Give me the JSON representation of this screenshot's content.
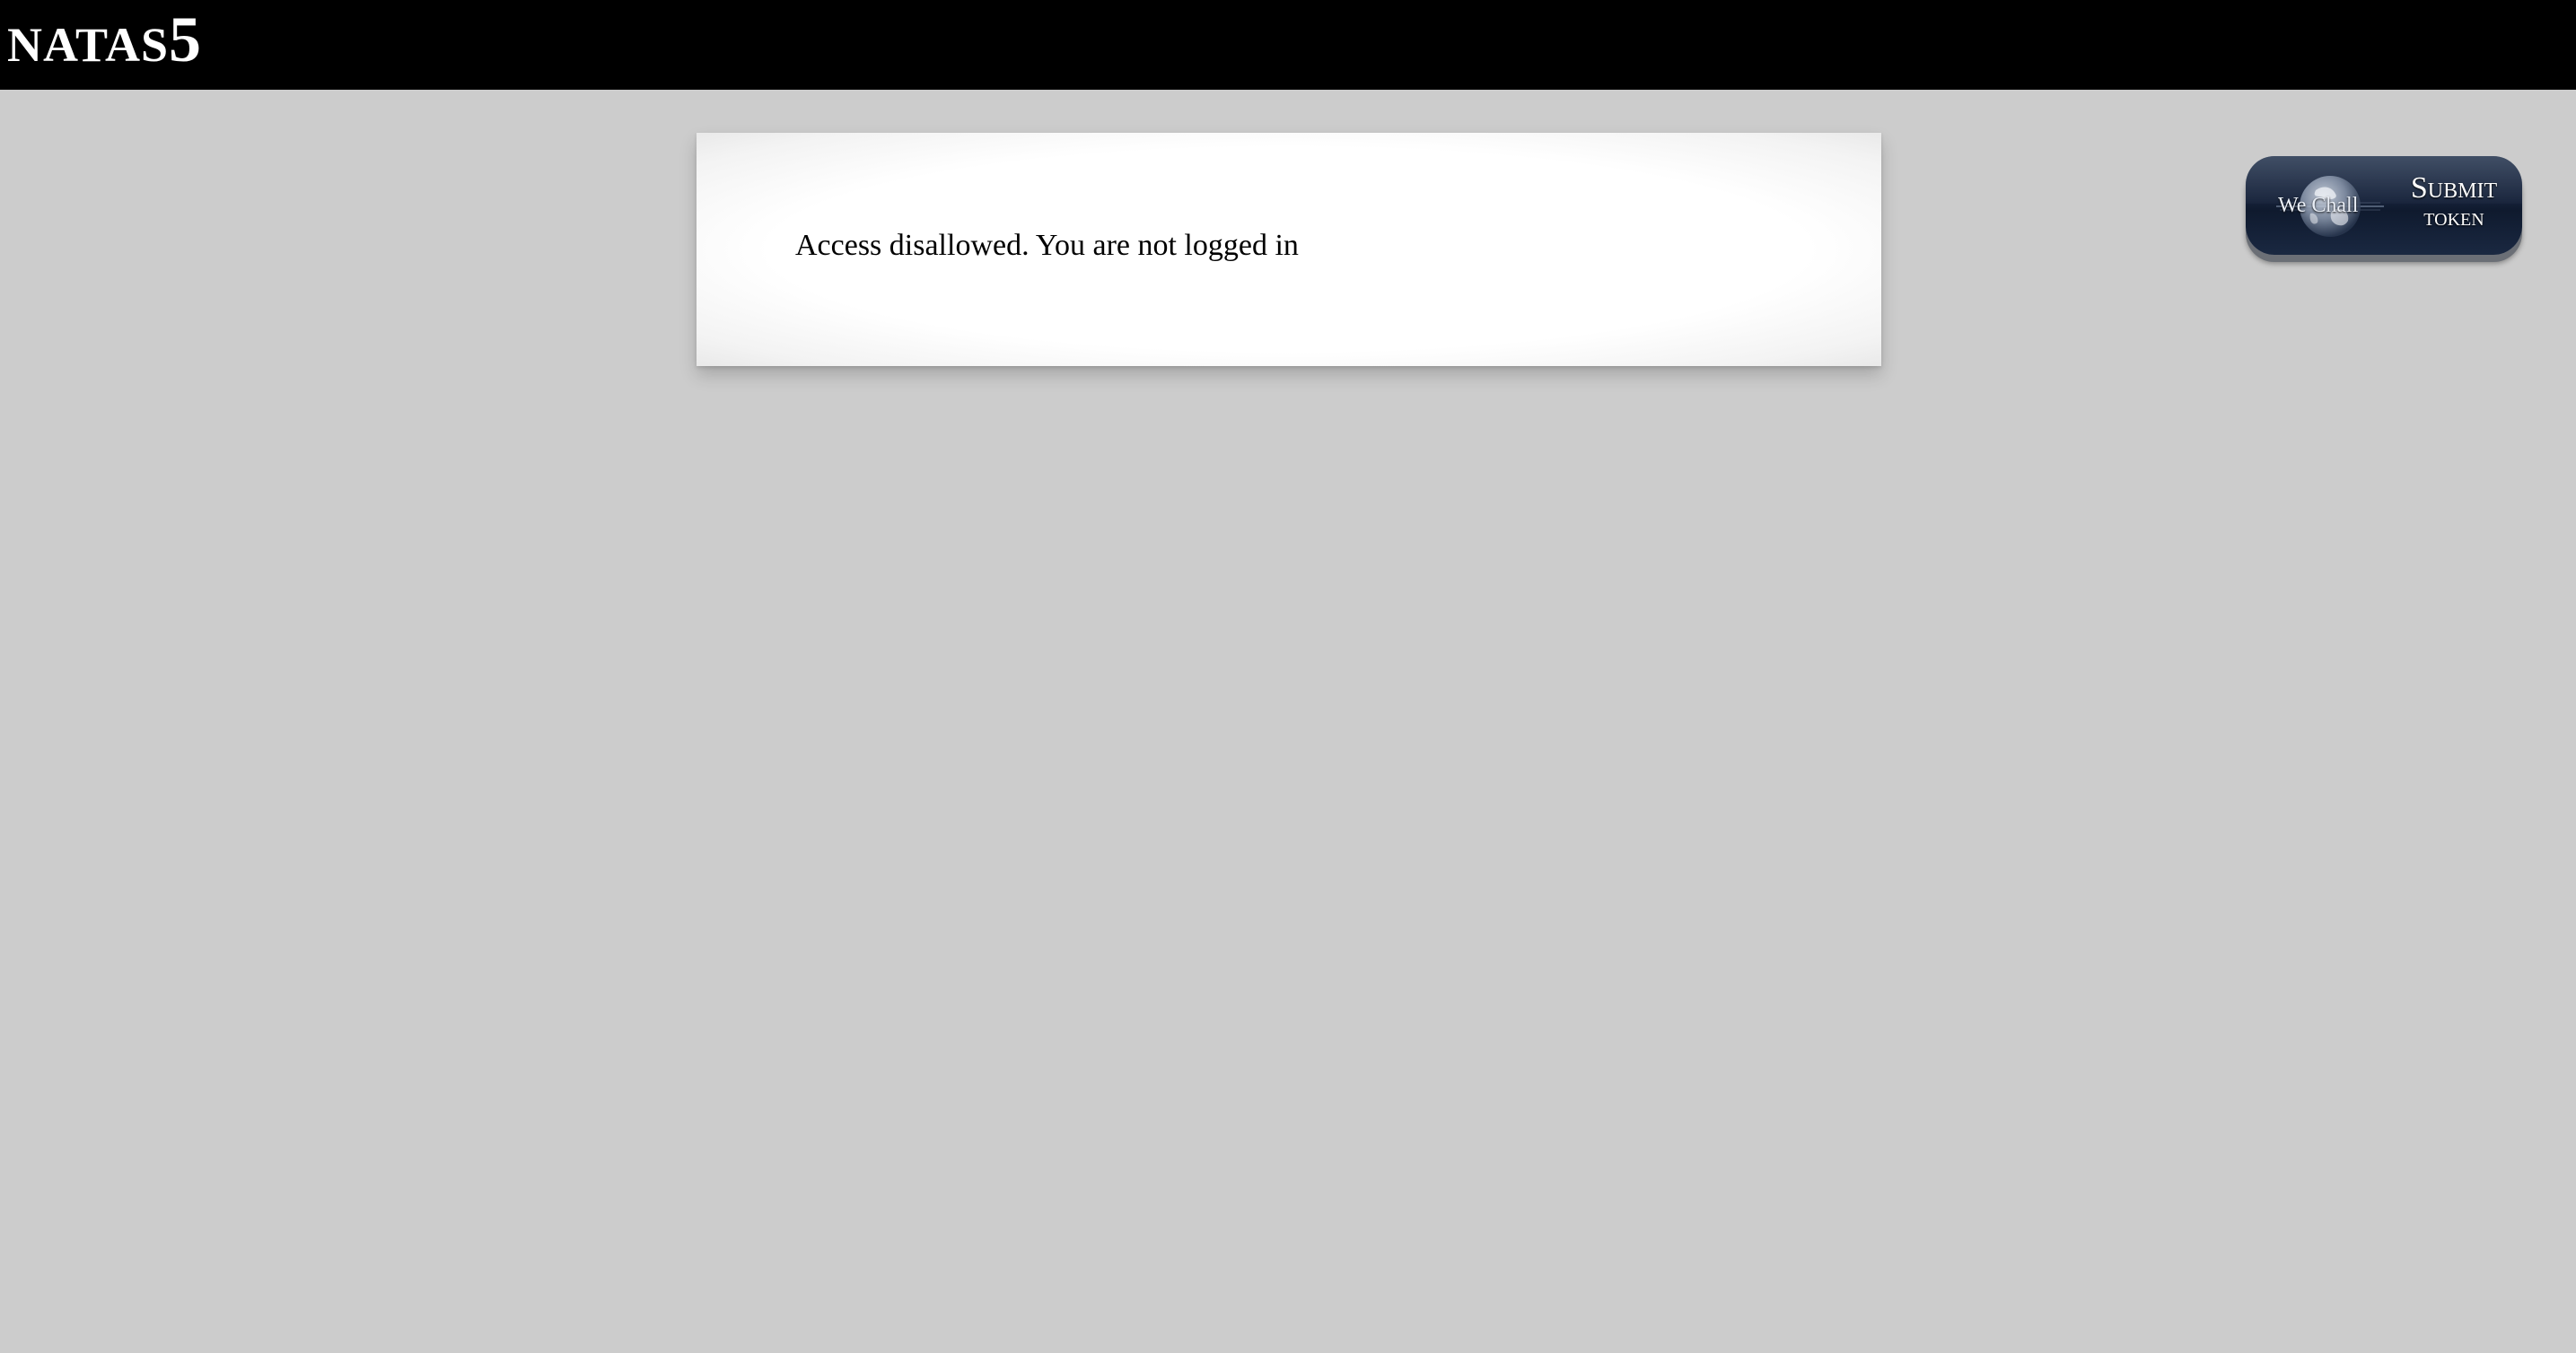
{
  "header": {
    "title_main": "NATAS",
    "title_number": "5"
  },
  "content": {
    "message": "Access disallowed. You are not logged in"
  },
  "wechall": {
    "logo_text": "We Chall",
    "submit_line_1": "Submit",
    "submit_line_2": "token",
    "icon": "globe-icon"
  },
  "colors": {
    "header_background": "#000000",
    "page_background": "#cccccc",
    "content_background": "#ffffff",
    "button_background": "#16223a"
  }
}
